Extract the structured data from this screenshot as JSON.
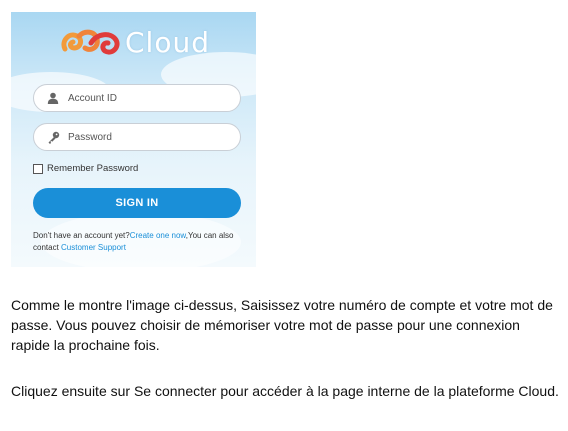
{
  "login": {
    "logo_text": "Cloud",
    "account_placeholder": "Account ID",
    "password_placeholder": "Password",
    "remember_label": "Remember Password",
    "remember_checked": false,
    "signin_label": "SIGN IN",
    "note_text": "Don't have an account yet?",
    "create_link": "Create one now",
    "note_middle": ",You can also contact ",
    "support_link": "Customer Support",
    "icons": {
      "account": "user-icon",
      "password": "key-icon",
      "logo": "cloud-logo-icon"
    },
    "colors": {
      "accent": "#1a8fd8",
      "link": "#1a8fd8",
      "logo_orange": "#f29a3a",
      "logo_red": "#e03b3b"
    }
  },
  "content": {
    "paragraph1": "Comme le montre l'image ci-dessus, Saisissez votre numéro de compte et votre mot de passe. Vous pouvez choisir de mémoriser votre mot de passe pour une connexion rapide la prochaine fois.",
    "paragraph2": "Cliquez ensuite sur Se connecter pour accéder à la page interne de la plateforme Cloud."
  }
}
